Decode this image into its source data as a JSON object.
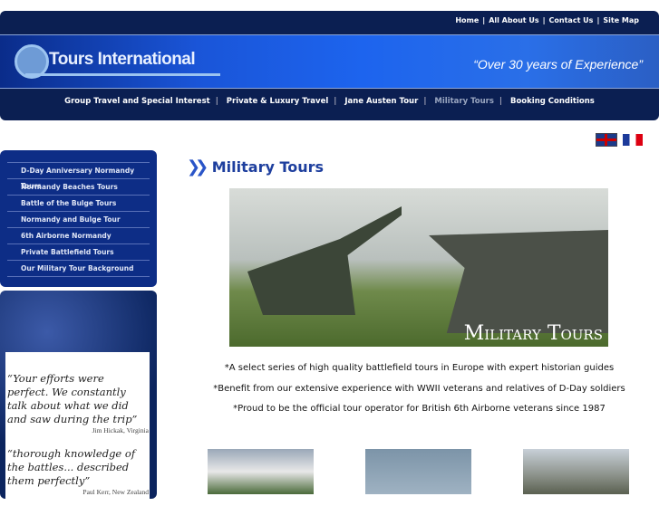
{
  "top_links": [
    "Home",
    "All About Us",
    "Contact Us",
    "Site Map"
  ],
  "logo_text": "Tours International",
  "slogan": "“Over 30 years of  Experience”",
  "nav": [
    "Group Travel and Special Interest",
    "Private & Luxury Travel",
    "Jane Austen Tour",
    "Military Tours",
    "Booking Conditions"
  ],
  "sidebar": [
    "D-Day Anniversary Normandy Tours",
    "Normandy Beaches Tours",
    "Battle of the Bulge Tours",
    "Normandy and Bulge Tour",
    "6th Airborne Normandy",
    "Private Battlefield Tours",
    "Our Military Tour Background"
  ],
  "quotes": [
    {
      "text": "“Your efforts were perfect. We constantly talk about what we did and saw during the trip”",
      "author": "Jim Hickak, Virginia"
    },
    {
      "text": "“thorough knowledge of the battles... described them perfectly”",
      "author": "Paul Kerr, New Zealand"
    }
  ],
  "page_title": "Military Tours",
  "hero_caption": "Military Tours",
  "bullets": [
    "*A select series of high quality battlefield tours in Europe with expert historian guides",
    "*Benefit from our extensive experience with WWII veterans and relatives of D-Day soldiers",
    "*Proud to be the official tour operator for British 6th Airborne veterans since 1987"
  ]
}
